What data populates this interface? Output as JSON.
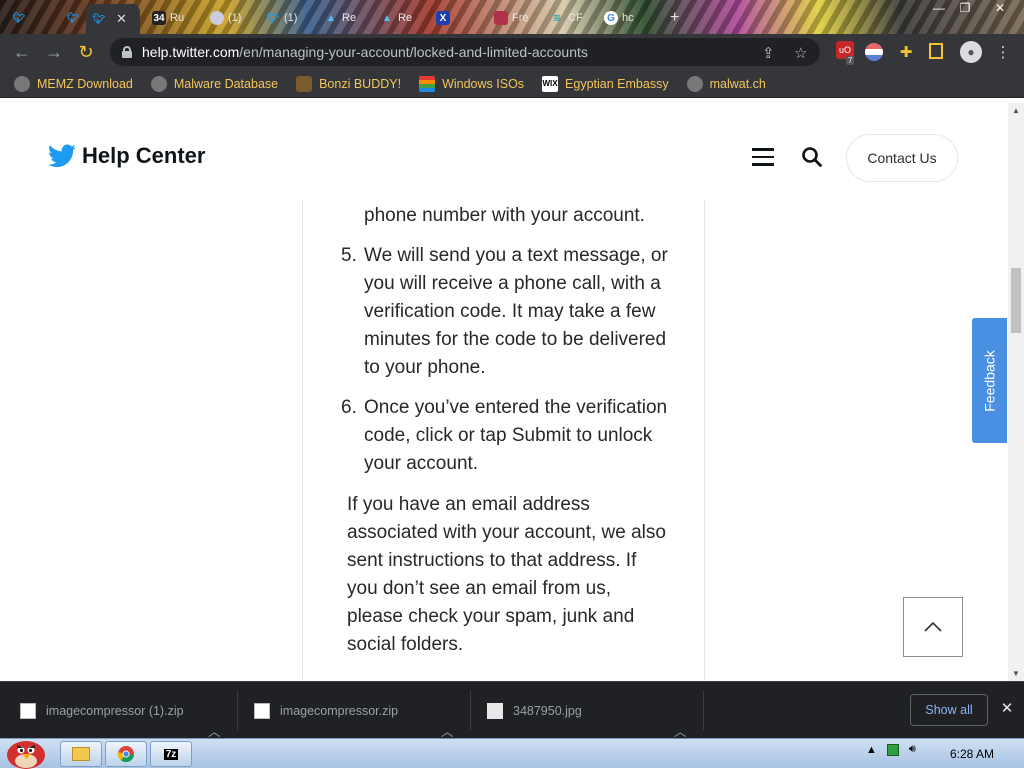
{
  "browser": {
    "tabs": [
      {
        "label": "",
        "icon": "twitter-icon"
      },
      {
        "label": "",
        "icon": "twitter-icon"
      },
      {
        "label": "",
        "icon": "twitter-icon",
        "active": true
      },
      {
        "label": "Ru",
        "icon": "counter-icon"
      },
      {
        "label": "(1)",
        "icon": "chat-icon"
      },
      {
        "label": "(1)",
        "icon": "twitter-icon"
      },
      {
        "label": "Re",
        "icon": "drive-icon"
      },
      {
        "label": "Re",
        "icon": "drive-icon"
      },
      {
        "label": "",
        "icon": "x-icon"
      },
      {
        "label": "Fre",
        "icon": "app-icon"
      },
      {
        "label": "CF",
        "icon": "stack-icon"
      },
      {
        "label": "hc",
        "icon": "google-icon"
      }
    ],
    "url_host": "help.twitter.com",
    "url_path": "/en/managing-your-account/locked-and-limited-accounts",
    "extension_badge": "7",
    "bookmarks": [
      {
        "label": "MEMZ Download",
        "icon": "globe-icon"
      },
      {
        "label": "Malware Database",
        "icon": "globe-icon"
      },
      {
        "label": "Bonzi BUDDY!",
        "icon": "bonzi-icon"
      },
      {
        "label": "Windows ISOs",
        "icon": "windows-icon"
      },
      {
        "label": "Egyptian Embassy",
        "icon": "wix-icon"
      },
      {
        "label": "malwat.ch",
        "icon": "globe-icon"
      }
    ]
  },
  "site": {
    "brand": "Help Center",
    "contact_label": "Contact Us",
    "feedback_label": "Feedback"
  },
  "article": {
    "prev_item_tail": "phone number with your account.",
    "steps": [
      {
        "num": "5.",
        "text": "We will send you a text message, or you will receive a phone call, with a verification code. It may take a few minutes for the code to be delivered to your phone."
      },
      {
        "num": "6.",
        "text": "Once you’ve entered the verification code, click or tap Submit to unlock your account."
      }
    ],
    "paragraph": "If you have an email address associated with your account, we also sent instructions to that address. If you don’t see an email from us, please check your spam, junk and social folders."
  },
  "downloads": {
    "items": [
      {
        "name": "imagecompressor (1).zip",
        "icon": "zip-icon"
      },
      {
        "name": "imagecompressor.zip",
        "icon": "zip-icon"
      },
      {
        "name": "3487950.jpg",
        "icon": "image-file-icon"
      }
    ],
    "show_all_label": "Show all"
  },
  "taskbar": {
    "clock": "6:28 AM",
    "pinned": [
      "explorer-icon",
      "chrome-icon",
      "7zip-icon"
    ],
    "pinned_labels": [
      "",
      "",
      "7z"
    ]
  },
  "colors": {
    "twitter_blue": "#1d9bf0",
    "feedback_blue": "#4a90e2",
    "bookmark_text": "#f5c65a",
    "show_all_text": "#8ab4f8"
  }
}
